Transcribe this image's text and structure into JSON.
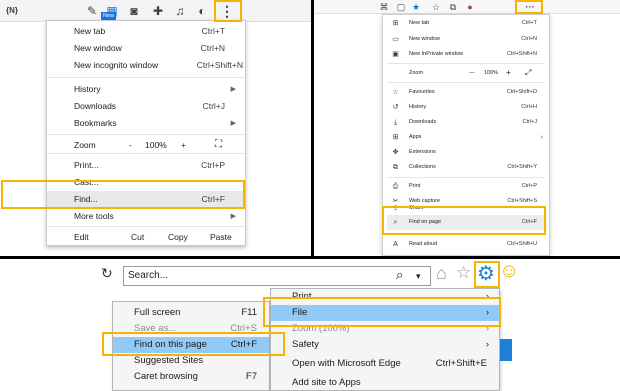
{
  "chrome": {
    "toolbar_icons": [
      {
        "name": "extension-icon-1",
        "glyph": "{N}"
      },
      {
        "name": "pen-icon",
        "glyph": "✎"
      },
      {
        "name": "new-extension-icon",
        "glyph": "▦"
      },
      {
        "name": "camera-icon",
        "glyph": "◙"
      },
      {
        "name": "puzzle-icon",
        "glyph": "✚"
      },
      {
        "name": "playlist-icon",
        "glyph": "♫"
      },
      {
        "name": "profile-icon",
        "glyph": "◐"
      }
    ],
    "new_badge": "New",
    "more_menu_icon": "⋮",
    "menu": {
      "new_tab": {
        "label": "New tab",
        "shortcut": "Ctrl+T"
      },
      "new_window": {
        "label": "New window",
        "shortcut": "Ctrl+N"
      },
      "new_incognito": {
        "label": "New incognito window",
        "shortcut": "Ctrl+Shift+N"
      },
      "history": {
        "label": "History"
      },
      "downloads": {
        "label": "Downloads",
        "shortcut": "Ctrl+J"
      },
      "bookmarks": {
        "label": "Bookmarks"
      },
      "zoom": {
        "label": "Zoom",
        "minus": "-",
        "value": "100%",
        "plus": "+",
        "fullscreen": "⛶"
      },
      "print": {
        "label": "Print...",
        "shortcut": "Ctrl+P"
      },
      "cast": {
        "label": "Cast..."
      },
      "find": {
        "label": "Find...",
        "shortcut": "Ctrl+F"
      },
      "more_tools": {
        "label": "More tools"
      },
      "edit": {
        "label": "Edit",
        "cut": "Cut",
        "copy": "Copy",
        "paste": "Paste"
      }
    },
    "arrow": "▶"
  },
  "edge": {
    "toolbar_icons": [
      {
        "name": "collections-icon",
        "glyph": "⌘"
      },
      {
        "name": "reader-icon",
        "glyph": "▢"
      },
      {
        "name": "favorite-star-icon",
        "glyph": "★"
      },
      {
        "name": "favorites-bar-icon",
        "glyph": "☆"
      },
      {
        "name": "collections-toolbar-icon",
        "glyph": "⧉"
      },
      {
        "name": "profile-icon",
        "glyph": "●"
      }
    ],
    "more_icon": "···",
    "menu": {
      "items_top": [
        {
          "name": "new-tab",
          "icon": "⊞",
          "label": "New tab",
          "shortcut": "Ctrl+T"
        },
        {
          "name": "new-window",
          "icon": "▭",
          "label": "New window",
          "shortcut": "Ctrl+N"
        },
        {
          "name": "new-inprivate",
          "icon": "▣",
          "label": "New InPrivate window",
          "shortcut": "Ctrl+Shift+N"
        }
      ],
      "zoom": {
        "label": "Zoom",
        "minus": "—",
        "value": "100%",
        "plus": "+",
        "expand": "⤢"
      },
      "items_mid": [
        {
          "name": "favourites",
          "icon": "☆",
          "label": "Favourites",
          "shortcut": "Ctrl+Shift+O"
        },
        {
          "name": "history",
          "icon": "↺",
          "label": "History",
          "shortcut": "Ctrl+H"
        },
        {
          "name": "downloads",
          "icon": "⤓",
          "label": "Downloads",
          "shortcut": "Ctrl+J"
        },
        {
          "name": "apps",
          "icon": "⊞",
          "label": "Apps",
          "shortcut": ""
        },
        {
          "name": "extensions",
          "icon": "✥",
          "label": "Extensions",
          "shortcut": ""
        },
        {
          "name": "collections",
          "icon": "⧉",
          "label": "Collections",
          "shortcut": "Ctrl+Shift+Y"
        }
      ],
      "items_bottom": [
        {
          "name": "print",
          "icon": "⎙",
          "label": "Print",
          "shortcut": "Ctrl+P"
        },
        {
          "name": "web-capture",
          "icon": "✂",
          "label": "Web capture",
          "shortcut": "Ctrl+Shift+S"
        },
        {
          "name": "share",
          "icon": "⇪",
          "label": "Share",
          "shortcut": ""
        },
        {
          "name": "find-on-page",
          "icon": "⌕",
          "label": "Find on page",
          "shortcut": "Ctrl+F"
        },
        {
          "name": "read-aloud",
          "icon": "A",
          "label": "Read aloud",
          "shortcut": "Ctrl+Shift+U"
        }
      ]
    },
    "arrow": "›"
  },
  "ie": {
    "refresh_icon": "↻",
    "search_placeholder": "Search...",
    "search_icon": "⌕",
    "dropdown_icon": "▾",
    "home_icon": "⌂",
    "star_icon": "☆",
    "gear_icon": "⚙",
    "smiley_icon": "☺",
    "left_menu": [
      {
        "name": "full-screen",
        "label": "Full screen",
        "shortcut": "F11"
      },
      {
        "name": "save-as",
        "label": "Save as...",
        "shortcut": "Ctrl+S"
      },
      {
        "name": "find-on-this-page",
        "label": "Find on this page",
        "shortcut": "Ctrl+F"
      },
      {
        "name": "suggested-sites",
        "label": "Suggested Sites",
        "shortcut": ""
      },
      {
        "name": "caret-browsing",
        "label": "Caret browsing",
        "shortcut": "F7"
      }
    ],
    "right_menu": [
      {
        "name": "print",
        "label": "Print",
        "shortcut": ""
      },
      {
        "name": "file",
        "label": "File",
        "shortcut": ""
      },
      {
        "name": "zoom",
        "label": "Zoom (100%)",
        "shortcut": ""
      },
      {
        "name": "safety",
        "label": "Safety",
        "shortcut": ""
      },
      {
        "name": "open-edge",
        "label": "Open with Microsoft Edge",
        "shortcut": "Ctrl+Shift+E"
      },
      {
        "name": "add-site",
        "label": "Add site to Apps",
        "shortcut": ""
      }
    ],
    "arrow": "›"
  },
  "colors": {
    "highlight_box": "#f4b400",
    "ie_selection": "#91c9f7",
    "edge_blue": "#0078d4"
  }
}
